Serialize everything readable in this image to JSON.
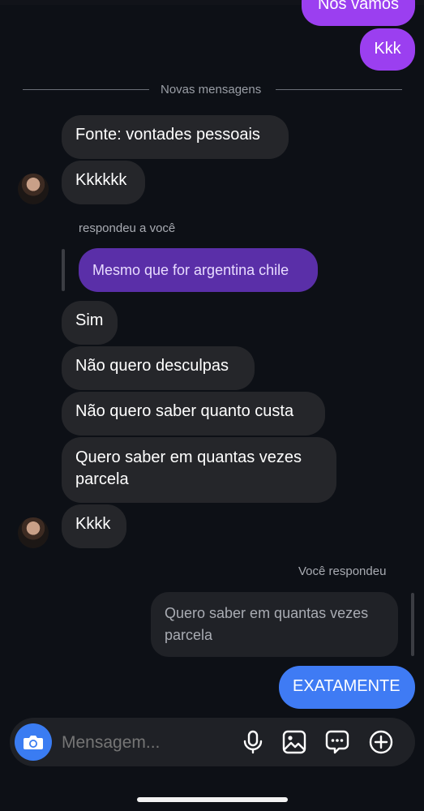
{
  "messages": {
    "top_partial": "Nós vamos",
    "kkk_sent": "Kkk",
    "fonte": "Fonte: vontades pessoais",
    "kkkkkk": "Kkkkkk",
    "quoted_purple": "Mesmo que for argentina chile",
    "sim": "Sim",
    "desculpas": "Não quero desculpas",
    "quanto_custa": "Não quero saber quanto custa",
    "parcela": "Quero saber em quantas vezes parcela",
    "kkkk": "Kkkk",
    "quoted_gray": "Quero saber em quantas vezes parcela",
    "exatamente": "EXATAMENTE"
  },
  "meta": {
    "new_messages": "Novas mensagens",
    "replied_to_you": "respondeu a você",
    "you_replied": "Você respondeu"
  },
  "composer": {
    "placeholder": "Mensagem..."
  },
  "icons": {
    "camera": "camera-icon",
    "mic": "microphone-icon",
    "gallery": "image-icon",
    "sticker": "chat-bubble-icon",
    "plus": "plus-circle-icon"
  },
  "colors": {
    "background": "#0d1016",
    "incoming_bubble": "#25262a",
    "sent_purple": "#9b3ff0",
    "sent_blue": "#3f7bf4",
    "quoted_purple": "#5a2fa8"
  }
}
